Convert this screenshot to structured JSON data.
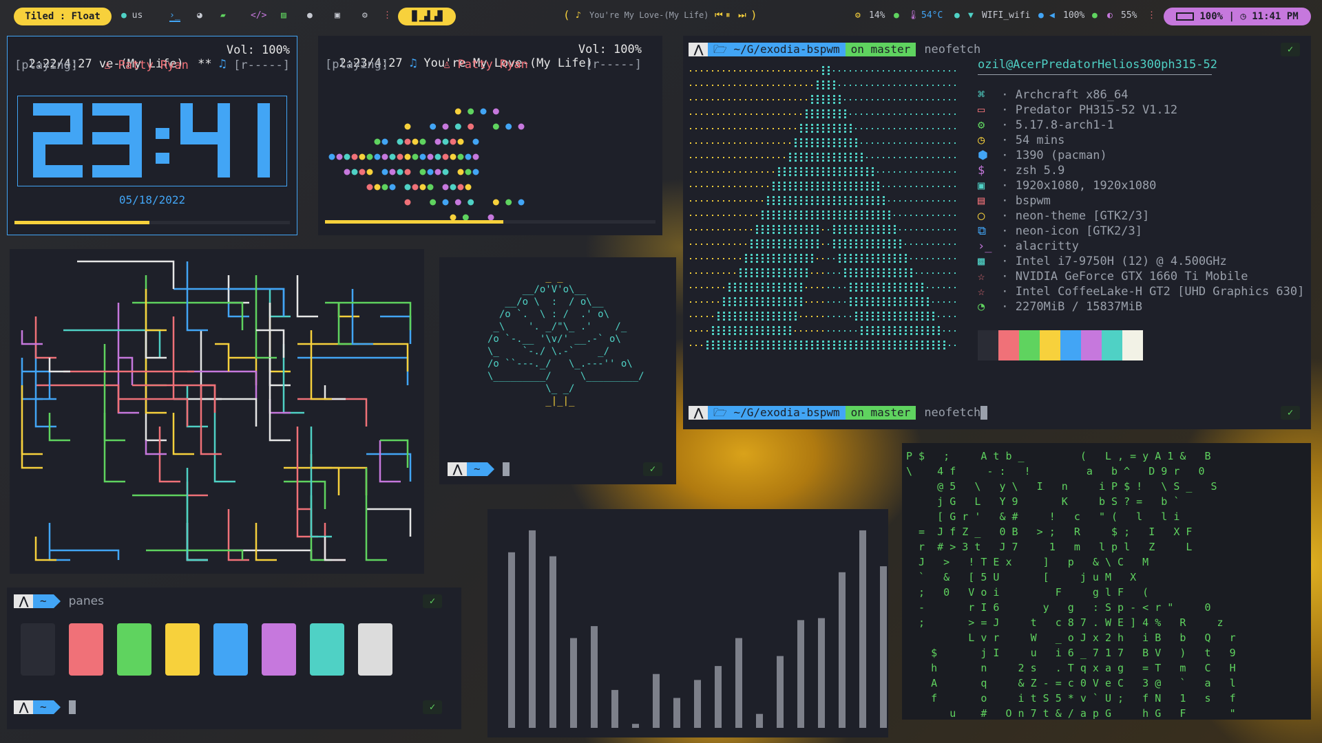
{
  "topbar": {
    "mode_label": "Tiled : Float",
    "layout": "us",
    "workspaces_label": "▐▌▁▟▁▟▌",
    "music_title": "You're My Love-(My Life)",
    "cpu": "14%",
    "temp": "54°C",
    "wifi": "WIFI_wifi",
    "volume": "100%",
    "brightness": "55%",
    "battery": "100%",
    "clock": "11:41 PM",
    "colors": {
      "accent": "#f7d13c",
      "bg": "#1c1e26",
      "battery_pill": "#c678dd"
    }
  },
  "player1": {
    "time": "2:22/4:27",
    "title": "ve-(My Life)",
    "stars": "**",
    "vol": "Vol: 100%",
    "status": "[playing]",
    "artist": "Patty Ryan",
    "progress_text": "[r-----]",
    "progress": 0.49
  },
  "clock_widget": {
    "time": "23:41",
    "date": "05/18/2022"
  },
  "player2": {
    "time": "2:23/4:27",
    "title": "You're My Love-(My Life)",
    "vol": "Vol: 100%",
    "status": "[playing]",
    "artist": "Patty Ryan",
    "progress_text": "[r-----]",
    "progress": 0.54
  },
  "neofetch": {
    "prompt_path": "~/G/exodia-bspwm",
    "prompt_branch": "on  master",
    "command": "neofetch",
    "user_host": "ozil@AcerPredatorHelios300ph315-52",
    "rows": [
      {
        "icon": "⌘",
        "color": "#4fd1c5",
        "text": "Archcraft x86_64"
      },
      {
        "icon": "▭",
        "color": "#f07178",
        "text": "Predator PH315-52 V1.12"
      },
      {
        "icon": "⚙",
        "color": "#5fd35f",
        "text": "5.17.8-arch1-1"
      },
      {
        "icon": "◷",
        "color": "#f7d13c",
        "text": "54 mins"
      },
      {
        "icon": "⬢",
        "color": "#42a5f5",
        "text": "1390 (pacman)"
      },
      {
        "icon": "$",
        "color": "#c678dd",
        "text": "zsh 5.9"
      },
      {
        "icon": "▣",
        "color": "#4fd1c5",
        "text": "1920x1080, 1920x1080"
      },
      {
        "icon": "▤",
        "color": "#f07178",
        "text": "bspwm"
      },
      {
        "icon": "◯",
        "color": "#f7d13c",
        "text": "neon-theme [GTK2/3]"
      },
      {
        "icon": "⧉",
        "color": "#42a5f5",
        "text": "neon-icon [GTK2/3]"
      },
      {
        "icon": "›_",
        "color": "#c678dd",
        "text": "alacritty"
      },
      {
        "icon": "▩",
        "color": "#4fd1c5",
        "text": "Intel i7-9750H (12) @ 4.500GHz"
      },
      {
        "icon": "☆",
        "color": "#f07178",
        "text": "NVIDIA GeForce GTX 1660 Ti Mobile"
      },
      {
        "icon": "☆",
        "color": "#f07178",
        "text": "Intel CoffeeLake-H GT2 [UHD Graphics 630]"
      },
      {
        "icon": "◔",
        "color": "#5fd35f",
        "text": "2270MiB / 15837MiB"
      }
    ],
    "palette": [
      "#2a2c35",
      "#f07178",
      "#5fd35f",
      "#f7d13c",
      "#42a5f5",
      "#c678dd",
      "#4fd1c5",
      "#f2f2e6"
    ],
    "prompt2_command": "neofetch"
  },
  "mini_term": {
    "prompt": "~"
  },
  "panes": {
    "label": "panes",
    "prompt": "~",
    "colors": [
      "#2a2c35",
      "#f07178",
      "#5fd35f",
      "#f7d13c",
      "#42a5f5",
      "#c678dd",
      "#4fd1c5",
      "#dcdcdc"
    ]
  },
  "visualizer": {
    "bars": [
      0.88,
      0.99,
      0.86,
      0.45,
      0.51,
      0.19,
      0.02,
      0.27,
      0.15,
      0.24,
      0.31,
      0.45,
      0.07,
      0.36,
      0.54,
      0.55,
      0.78,
      0.99,
      0.81
    ]
  },
  "matrix": {
    "lines": [
      "P $   ;     A t b _         (   L , = y A 1 &   B",
      "\\    4 f     - :   !         a   b ^   D 9 r   0",
      "     @ 5   \\   y \\   I   n     i P $ !   \\ S _   S",
      "     j G   L   Y 9       K     b S ? =   b `",
      "     [ G r '   & #     !   c   \" (   l   l i",
      "  =  J f Z _   0 B   > ;   R     $ ;   I   X F",
      "  r  # > 3 t   J 7     1   m   l p l   Z     L",
      "  J   >   ! T E x     ]   p   & \\ C   M",
      "  `   &   [ 5 U       [     j u M   X",
      "  ;   0   V o i         F     g l F   (",
      "  -       r I 6       y   g   : S p - < r \"     0",
      "  ;       > = J     t   c 8 7 . W E ] 4 %   R     z",
      "          L v r     W   _ o J x 2 h   i B   b   Q   r",
      "    $       j I     u   i 6 _ 7 1 7   B V   )   t   9",
      "    h       n     2 s   . T q x a g   = T   m   C   H",
      "    A       q     & Z - = c 0 V e C   3 @   `   a   l",
      "    f       o     i t S 5 * v ` U ;   f N   1   s   f",
      "       u    #   O n 7 t & / a p G     h G   F       \""
    ]
  }
}
